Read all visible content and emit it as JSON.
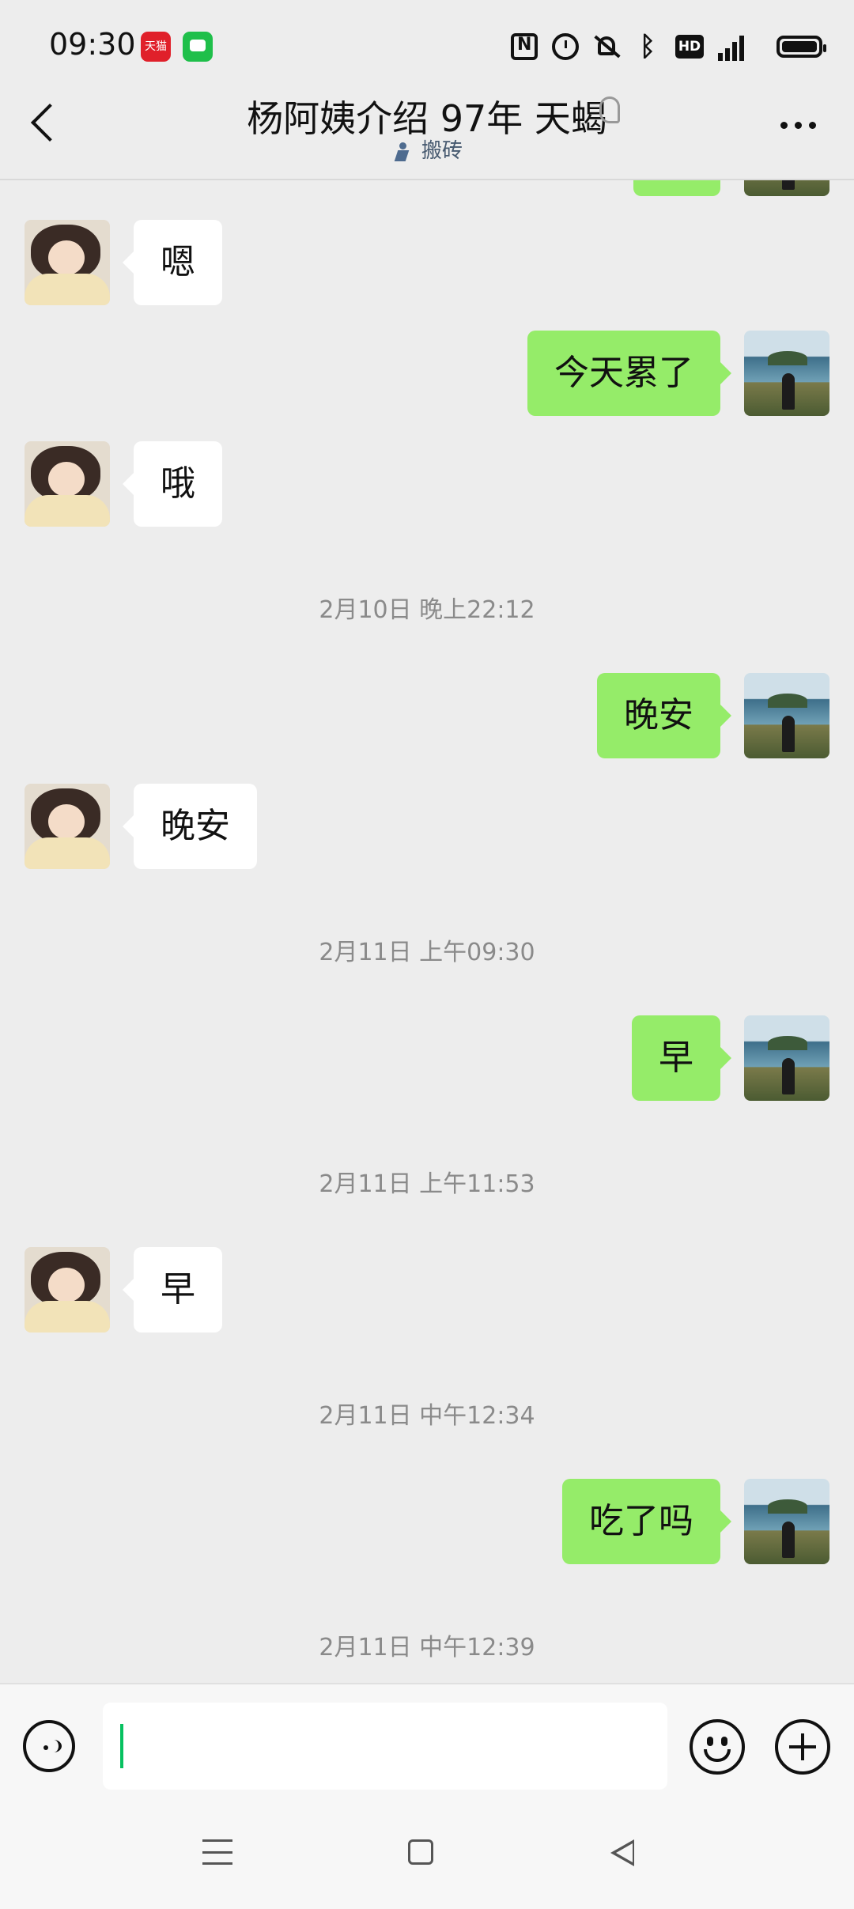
{
  "status_bar": {
    "time": "09:30",
    "tmall_icon_label": "天猫",
    "icons": [
      "nfc-icon",
      "alarm-icon",
      "mute-icon",
      "bluetooth-icon",
      "hd-icon",
      "5g-signal-icon",
      "battery-icon"
    ],
    "hd_label": "HD",
    "bluetooth_glyph": "ᛒ"
  },
  "header": {
    "title": "杨阿姨介绍 97年 天蝎",
    "status_text": "搬砖",
    "back_icon": "chevron-left-icon",
    "more_icon": "more-dots-icon"
  },
  "messages": [
    {
      "type": "msg",
      "side": "in",
      "text": "嗯"
    },
    {
      "type": "msg",
      "side": "out",
      "text": "今天累了"
    },
    {
      "type": "msg",
      "side": "in",
      "text": "哦"
    },
    {
      "type": "time",
      "text": "2月10日 晚上22:12"
    },
    {
      "type": "msg",
      "side": "out",
      "text": "晚安"
    },
    {
      "type": "msg",
      "side": "in",
      "text": "晚安"
    },
    {
      "type": "time",
      "text": "2月11日 上午09:30"
    },
    {
      "type": "msg",
      "side": "out",
      "text": "早"
    },
    {
      "type": "time",
      "text": "2月11日 上午11:53"
    },
    {
      "type": "msg",
      "side": "in",
      "text": "早"
    },
    {
      "type": "time",
      "text": "2月11日 中午12:34"
    },
    {
      "type": "msg",
      "side": "out",
      "text": "吃了吗"
    },
    {
      "type": "time",
      "text": "2月11日 中午12:39"
    }
  ],
  "input_bar": {
    "value": "",
    "voice_icon": "voice-icon",
    "emoji_icon": "emoji-icon",
    "plus_icon": "plus-icon"
  },
  "colors": {
    "background": "#ededed",
    "outgoing_bubble": "#95ec69",
    "incoming_bubble": "#ffffff",
    "caret": "#07c160"
  }
}
